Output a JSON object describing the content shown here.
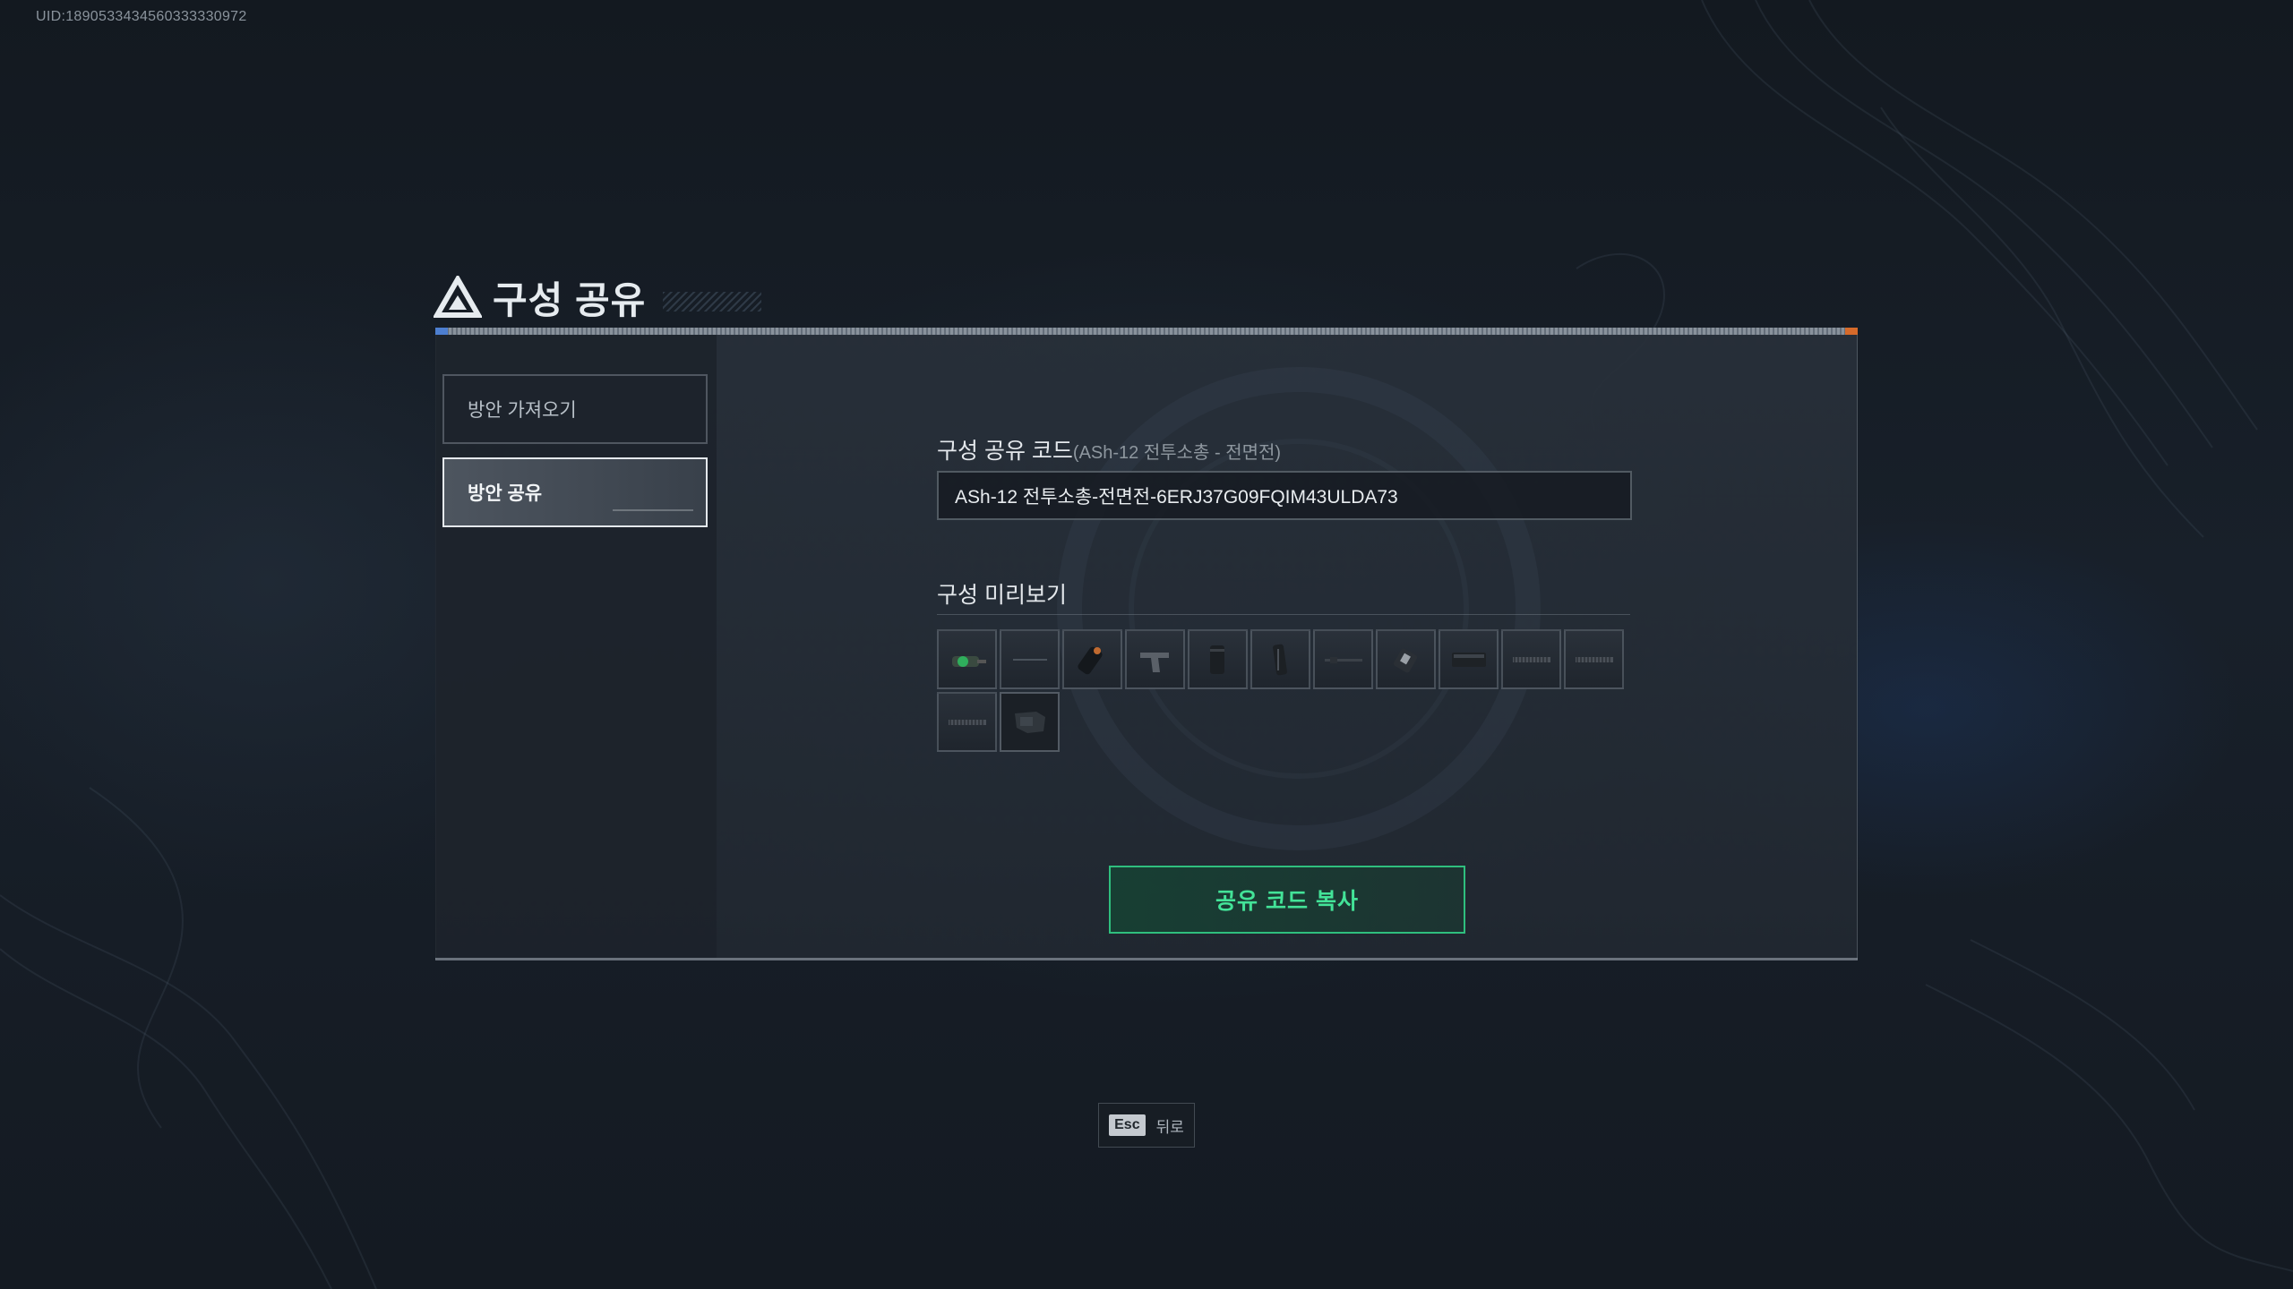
{
  "uid": "UID:1890533434560333330972",
  "dialog": {
    "title": "구성 공유",
    "tabs": [
      {
        "label": "방안 가져오기",
        "active": false
      },
      {
        "label": "방안 공유",
        "active": true
      }
    ],
    "share_code": {
      "label": "구성 공유 코드",
      "sub_label": "(ASh-12 전투소총 - 전면전)",
      "value": "ASh-12 전투소총-전면전-6ERJ37G09FQIM43ULDA73"
    },
    "preview": {
      "label": "구성 미리보기",
      "slots": [
        {
          "icon": "green-sight-icon"
        },
        {
          "icon": "thin-rail-icon"
        },
        {
          "icon": "flashlight-icon"
        },
        {
          "icon": "grip-icon"
        },
        {
          "icon": "suppressor-icon"
        },
        {
          "icon": "magazine-icon"
        },
        {
          "icon": "long-barrel-icon"
        },
        {
          "icon": "laser-module-icon"
        },
        {
          "icon": "receiver-cover-icon"
        },
        {
          "icon": "rail-panel-icon"
        },
        {
          "icon": "rail-panel-icon"
        },
        {
          "icon": "rail-panel-icon"
        },
        {
          "icon": "stock-icon"
        }
      ]
    },
    "copy_button": "공유 코드 복사"
  },
  "footer": {
    "key": "Esc",
    "label": "뒤로"
  },
  "colors": {
    "accent_green": "#43e398",
    "accent_blue": "#4d7fd0",
    "accent_orange": "#d66a2a"
  }
}
